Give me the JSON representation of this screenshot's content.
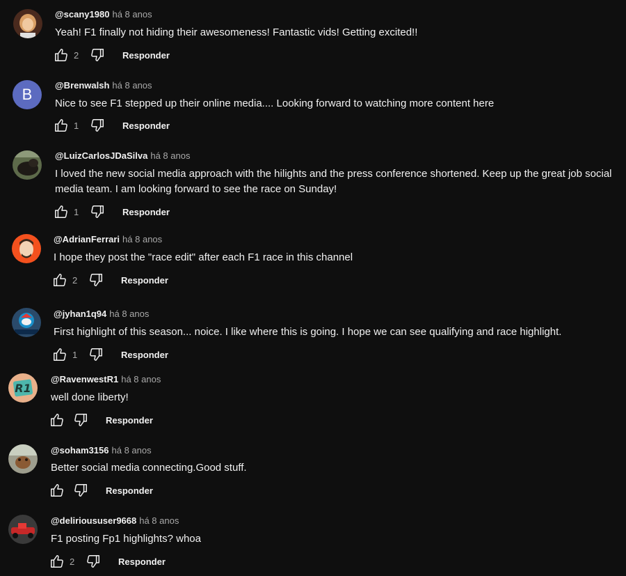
{
  "reply_label": "Responder",
  "icons": {
    "like": "thumb-up-icon",
    "dislike": "thumb-down-icon"
  },
  "comments": [
    {
      "author": "@scany1980",
      "time": "há 8 anos",
      "text": "Yeah! F1 finally not hiding their awesomeness! Fantastic vids! Getting excited!!",
      "likes": "2"
    },
    {
      "author": "@Brenwalsh",
      "time": "há 8 anos",
      "text": "Nice to see F1 stepped up their online media.... Looking forward to watching more content here",
      "likes": "1",
      "avatar_letter": "B"
    },
    {
      "author": "@LuizCarlosJDaSilva",
      "time": "há 8 anos",
      "text": "I loved the new social media approach with the hilights and the press conference shortened. Keep up the great job social media team. I am looking forward to see the race on Sunday!",
      "likes": "1"
    },
    {
      "author": "@AdrianFerrari",
      "time": "há 8 anos",
      "text": "I hope they post the \"race edit\" after each F1 race in this channel",
      "likes": "2"
    },
    {
      "author": "@jyhan1q94",
      "time": "há 8 anos",
      "text": "First highlight of this season... noice. I like where this is going. I hope we can see qualifying and race highlight.",
      "likes": "1"
    },
    {
      "author": "@RavenwestR1",
      "time": "há 8 anos",
      "text": "well done liberty!",
      "likes": ""
    },
    {
      "author": "@soham3156",
      "time": "há 8 anos",
      "text": "Better social media connecting.Good stuff.",
      "likes": ""
    },
    {
      "author": "@delirioususer9668",
      "time": "há 8 anos",
      "text": "F1 posting Fp1 highlights? whoa",
      "likes": "2"
    }
  ]
}
